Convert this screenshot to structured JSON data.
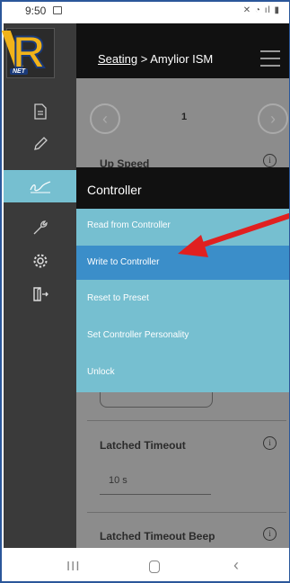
{
  "status_bar": {
    "time": "9:50",
    "right_icons": "✕ ◔ ıl ▮"
  },
  "header": {
    "breadcrumb_link": "Seating",
    "breadcrumb_separator": " > ",
    "breadcrumb_current": "Amylior ISM"
  },
  "logo": {
    "net_label": "NET",
    "letter": "R"
  },
  "pager": {
    "current_page": "1"
  },
  "settings": [
    {
      "label": "Up Speed"
    },
    {
      "label": "Latched Timeout",
      "value": "10 s"
    },
    {
      "label": "Latched Timeout Beep"
    }
  ],
  "dropdown": {
    "title": "Controller",
    "items": [
      {
        "label": "Read from Controller"
      },
      {
        "label": "Write to Controller"
      },
      {
        "label": "Reset to Preset"
      },
      {
        "label": "Set Controller Personality"
      },
      {
        "label": "Unlock"
      }
    ],
    "selected_index": 1
  },
  "colors": {
    "menu_bg": "#76bfd0",
    "menu_selected": "#3b8ec9",
    "header_bg": "#111111",
    "sidebar_bg": "#3a3a3a",
    "arrow": "#e02020"
  },
  "icons": {
    "sidebar": [
      "document-icon",
      "pencil-icon",
      "hand-signature-icon",
      "wrench-icon",
      "gear-icon",
      "exit-door-icon"
    ]
  }
}
